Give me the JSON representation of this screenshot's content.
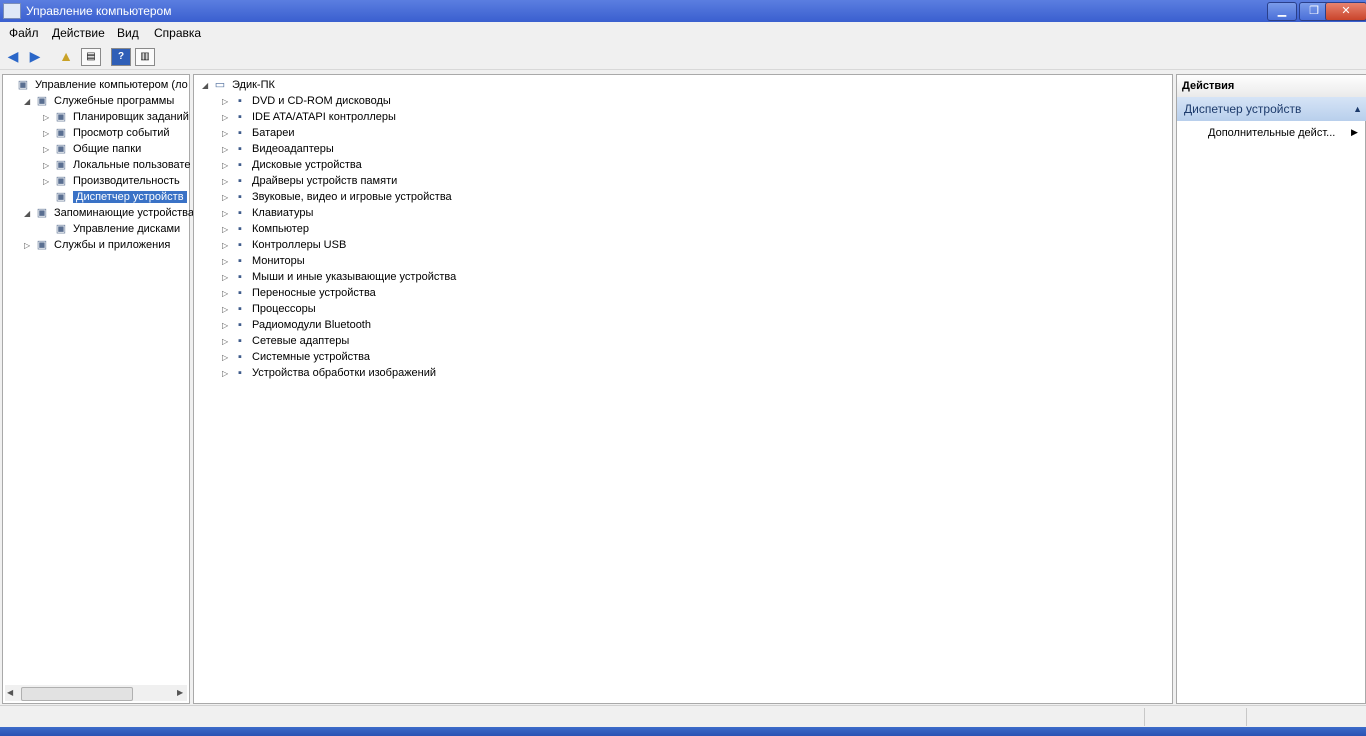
{
  "window": {
    "title": "Управление компьютером"
  },
  "menu": [
    "Файл",
    "Действие",
    "Вид",
    "Справка"
  ],
  "left_tree": [
    {
      "label": "Управление компьютером (ло",
      "icon": "computer-management-icon",
      "level": 0,
      "expander": ""
    },
    {
      "label": "Служебные программы",
      "icon": "tools-icon",
      "level": 1,
      "expander": "◢"
    },
    {
      "label": "Планировщик заданий",
      "icon": "clock-icon",
      "level": 2,
      "expander": "▷"
    },
    {
      "label": "Просмотр событий",
      "icon": "event-viewer-icon",
      "level": 2,
      "expander": "▷"
    },
    {
      "label": "Общие папки",
      "icon": "shared-folders-icon",
      "level": 2,
      "expander": "▷"
    },
    {
      "label": "Локальные пользовате",
      "icon": "users-icon",
      "level": 2,
      "expander": "▷"
    },
    {
      "label": "Производительность",
      "icon": "performance-icon",
      "level": 2,
      "expander": "▷"
    },
    {
      "label": "Диспетчер устройств",
      "icon": "device-manager-icon",
      "level": 2,
      "expander": "",
      "selected": true
    },
    {
      "label": "Запоминающие устройства",
      "icon": "storage-icon",
      "level": 1,
      "expander": "◢"
    },
    {
      "label": "Управление дисками",
      "icon": "disk-management-icon",
      "level": 2,
      "expander": ""
    },
    {
      "label": "Службы и приложения",
      "icon": "services-icon",
      "level": 1,
      "expander": "▷"
    }
  ],
  "device_tree": {
    "root": "Эдик-ПК",
    "items": [
      {
        "label": "DVD и CD-ROM дисководы",
        "icon": "dvd-icon"
      },
      {
        "label": "IDE ATA/ATAPI контроллеры",
        "icon": "ide-controller-icon"
      },
      {
        "label": "Батареи",
        "icon": "battery-icon"
      },
      {
        "label": "Видеоадаптеры",
        "icon": "video-adapter-icon"
      },
      {
        "label": "Дисковые устройства",
        "icon": "disk-drive-icon"
      },
      {
        "label": "Драйверы устройств памяти",
        "icon": "memory-driver-icon"
      },
      {
        "label": "Звуковые, видео и игровые устройства",
        "icon": "sound-icon"
      },
      {
        "label": "Клавиатуры",
        "icon": "keyboard-icon"
      },
      {
        "label": "Компьютер",
        "icon": "computer-icon"
      },
      {
        "label": "Контроллеры USB",
        "icon": "usb-icon"
      },
      {
        "label": "Мониторы",
        "icon": "monitor-icon"
      },
      {
        "label": "Мыши и иные указывающие устройства",
        "icon": "mouse-icon"
      },
      {
        "label": "Переносные устройства",
        "icon": "portable-device-icon"
      },
      {
        "label": "Процессоры",
        "icon": "processor-icon"
      },
      {
        "label": "Радиомодули Bluetooth",
        "icon": "bluetooth-icon"
      },
      {
        "label": "Сетевые адаптеры",
        "icon": "network-adapter-icon"
      },
      {
        "label": "Системные устройства",
        "icon": "system-device-icon"
      },
      {
        "label": "Устройства обработки изображений",
        "icon": "imaging-device-icon"
      }
    ]
  },
  "actions": {
    "header": "Действия",
    "section": "Диспетчер устройств",
    "item": "Дополнительные дейст..."
  }
}
